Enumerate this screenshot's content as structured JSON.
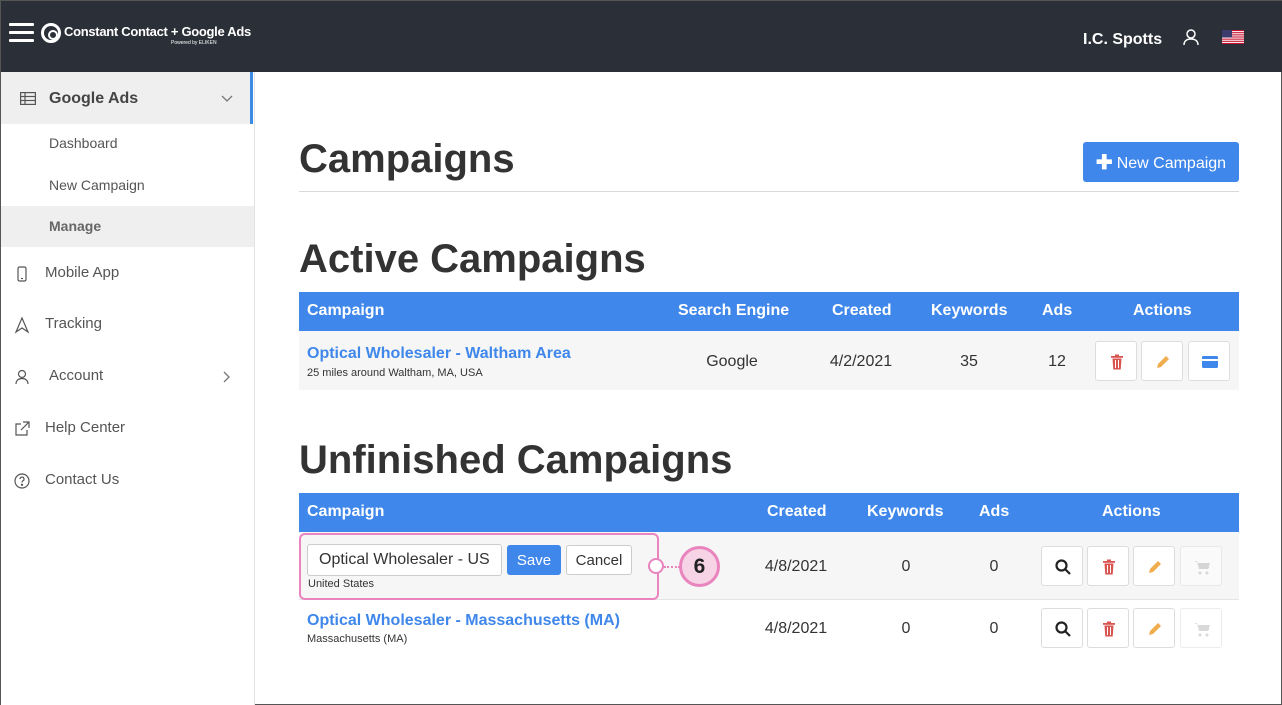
{
  "header": {
    "app_name": "Constant Contact + Google Ads",
    "powered_by": "Powered by ELIKEN",
    "user_name": "I.C. Spotts"
  },
  "sidebar": {
    "section_label": "Google Ads",
    "sub_items": [
      {
        "label": "Dashboard"
      },
      {
        "label": "New Campaign"
      },
      {
        "label": "Manage",
        "active": true
      }
    ],
    "items": [
      {
        "label": "Mobile App",
        "icon": "phone-icon"
      },
      {
        "label": "Tracking",
        "icon": "tracking-icon"
      },
      {
        "label": "Account",
        "icon": "user-icon"
      },
      {
        "label": "Help Center",
        "icon": "external-link-icon"
      },
      {
        "label": "Contact Us",
        "icon": "question-icon"
      }
    ]
  },
  "page": {
    "title": "Campaigns",
    "new_campaign_label": "New Campaign"
  },
  "active": {
    "title": "Active Campaigns",
    "columns": [
      "Campaign",
      "Search Engine",
      "Created",
      "Keywords",
      "Ads",
      "Actions"
    ],
    "rows": [
      {
        "name": "Optical Wholesaler - Waltham Area",
        "location": "25 miles around Waltham, MA, USA",
        "engine": "Google",
        "created": "4/2/2021",
        "keywords": "35",
        "ads": "12"
      }
    ]
  },
  "unfinished": {
    "title": "Unfinished Campaigns",
    "columns": [
      "Campaign",
      "Created",
      "Keywords",
      "Ads",
      "Actions"
    ],
    "editing": {
      "input_value": "Optical Wholesaler - US",
      "save_label": "Save",
      "cancel_label": "Cancel",
      "location": "United States",
      "created": "4/8/2021",
      "keywords": "0",
      "ads": "0"
    },
    "rows": [
      {
        "name": "Optical Wholesaler - Massachusetts (MA)",
        "location": "Massachusetts (MA)",
        "created": "4/8/2021",
        "keywords": "0",
        "ads": "0"
      }
    ]
  },
  "callout": {
    "number": "6"
  },
  "colors": {
    "accent": "#3f87ea",
    "topbar": "#2b3038",
    "callout": "#ea84be",
    "delete": "#d9534f",
    "edit": "#f0ad4e"
  }
}
